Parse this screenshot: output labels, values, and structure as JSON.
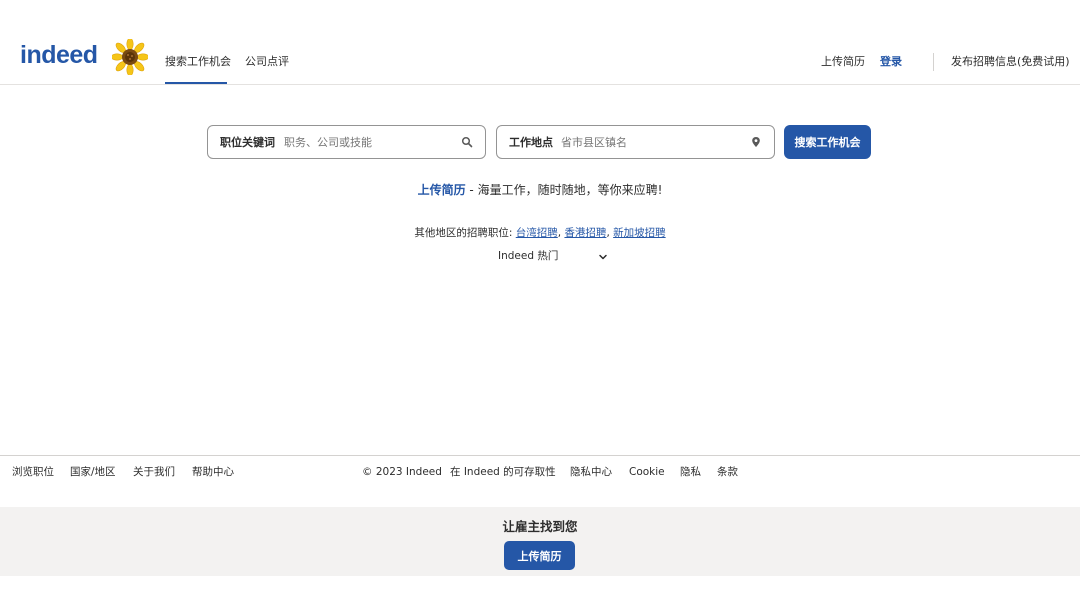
{
  "header": {
    "logo_text": "indeed",
    "nav": {
      "find_jobs": "搜索工作机会",
      "company_reviews": "公司点评"
    },
    "upload_resume": "上传简历",
    "sign_in": "登录",
    "employers_post": "发布招聘信息(免费试用)"
  },
  "search": {
    "what_label": "职位关键词",
    "what_placeholder": "职务、公司或技能",
    "what_value": "",
    "where_label": "工作地点",
    "where_placeholder": "省市县区镇名",
    "where_value": "",
    "submit_label": "搜索工作机会",
    "what_icon": "search-icon",
    "where_icon": "location-pin-icon"
  },
  "promo": {
    "link_text": "上传简历",
    "rest_text": " - 海量工作，随时随地，等你来应聘!"
  },
  "other_regions": {
    "label": "其他地区的招聘职位: ",
    "links": [
      "台湾招聘",
      "香港招聘",
      "新加坡招聘"
    ],
    "separator": ", "
  },
  "popular": {
    "label": "Indeed 热门",
    "icon": "chevron-down-icon"
  },
  "footer": {
    "left_links": [
      "浏览职位",
      "国家/地区",
      "关于我们",
      "帮助中心"
    ],
    "copyright": "© 2023 Indeed",
    "right_links": [
      "在 Indeed 的可存取性",
      "隐私中心",
      "Cookie",
      "隐私",
      "条款"
    ]
  },
  "banner": {
    "title": "让雇主找到您",
    "button_label": "上传简历"
  },
  "colors": {
    "brand_blue": "#2557a7",
    "text": "#2d2d2d",
    "banner_bg": "#f3f2f1",
    "sunflower_petal": "#f5c518",
    "sunflower_center": "#7a4a12"
  }
}
